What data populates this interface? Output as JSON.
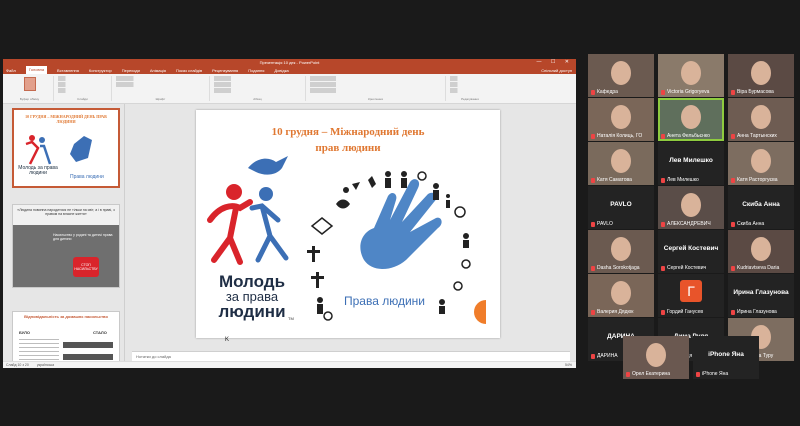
{
  "ppt": {
    "title": "Презентація 10 дек - PowerPoint",
    "window_controls": "— ☐ ✕",
    "menu": [
      "Файл",
      "Головна",
      "Вставлення",
      "Конструктор",
      "Переходи",
      "Анімація",
      "Показ слайдів",
      "Рецензування",
      "Подання",
      "Довідка"
    ],
    "active_menu_index": 1,
    "share": "Спільний доступ",
    "ribbon_groups": [
      "Буфер обміну",
      "Слайди",
      "Шрифт",
      "Абзац",
      "Креслення",
      "Редагування"
    ],
    "slide_numbers": [
      "2",
      "3",
      "4"
    ],
    "thumb1": {
      "title": "10 ГРУДНЯ – МІЖНАРОДНИЙ ДЕНЬ ПРАВ ЛЮДИНИ",
      "logo_left": "Молодь за права людини",
      "logo_right": "Права людини"
    },
    "thumb2": {
      "quote": "«Людина повинна народитися не тільки на світ, а і в праві, з правом на власне життя»",
      "caption": "Насильство у родині та дитячі права для дитини",
      "stop": "СТОП НАСИЛЬСТВУ"
    },
    "thumb3": {
      "title": "Відповідальність за домашнє насильство",
      "label_was": "БУЛО",
      "label_became": "СТАЛО"
    },
    "slide": {
      "title_line1": "10 грудня – Міжнародний день",
      "title_line2": "прав людини",
      "logo_left_line1": "Молодь",
      "logo_left_line2": "за права",
      "logo_left_line3": "людини",
      "logo_right_text": "Права людини",
      "tm": "TM"
    },
    "cursor_char": "K",
    "notes_placeholder": "Нотатки до слайда",
    "status": {
      "slide": "Слайд 10 з 20",
      "lang": "українська",
      "zoom": "54%"
    }
  },
  "participants": [
    {
      "name": "Кафедра",
      "full": "Кафедра соціальної р...",
      "kind": "video",
      "center": ""
    },
    {
      "name": "Victoria Grigoryeva",
      "kind": "video",
      "center": ""
    },
    {
      "name": "Віра Бурмасова",
      "kind": "video",
      "center": ""
    },
    {
      "name": "Наталія Колиць, ГО",
      "kind": "video",
      "center": ""
    },
    {
      "name": "Анета Фельбьєнко",
      "kind": "video",
      "center": "",
      "active": true
    },
    {
      "name": "Анна Тартынских",
      "kind": "video",
      "center": ""
    },
    {
      "name": "Катя Саматова",
      "kind": "video",
      "center": ""
    },
    {
      "name": "Лев Милешко",
      "kind": "name",
      "center": "Лев Милешко"
    },
    {
      "name": "Катя Расторгуєва",
      "kind": "video",
      "center": ""
    },
    {
      "name": "PAVLO",
      "kind": "name",
      "center": "PAVLO"
    },
    {
      "name": "АЛЕКСАНДРЕВИЧ",
      "kind": "video",
      "center": ""
    },
    {
      "name": "Скиба Анна",
      "kind": "name",
      "center": "Скиба Анна"
    },
    {
      "name": "Dasha Sorokotjaga",
      "kind": "video",
      "center": ""
    },
    {
      "name": "Сергей Костевич",
      "kind": "name",
      "center": "Сергей Костевич"
    },
    {
      "name": "Kudriavtseva Daria",
      "kind": "video",
      "center": ""
    },
    {
      "name": "Валерия Дядюк",
      "kind": "video",
      "center": ""
    },
    {
      "name": "Гордий Ганусев",
      "kind": "logo",
      "center": "Г"
    },
    {
      "name": "Ирина Глазунова",
      "kind": "name",
      "center": "Ирина Глазунова"
    },
    {
      "name": "ДАРИНА",
      "kind": "name",
      "center": "ДАРИНА"
    },
    {
      "name": "Дима Рудя",
      "kind": "name",
      "center": "Дима Рудя"
    },
    {
      "name": "Екатерина Туру",
      "kind": "video",
      "center": ""
    },
    {
      "name": "Орел Екатерина",
      "kind": "video",
      "center": ""
    },
    {
      "name": "iPhone Яна",
      "kind": "name",
      "center": "iPhone Яна"
    }
  ],
  "colors": {
    "ppt_red": "#b7472a",
    "orange_title": "#e07832",
    "active_speaker": "#8ecb3f",
    "logo_blue": "#3c6fb5",
    "logo_red": "#d9242b"
  }
}
